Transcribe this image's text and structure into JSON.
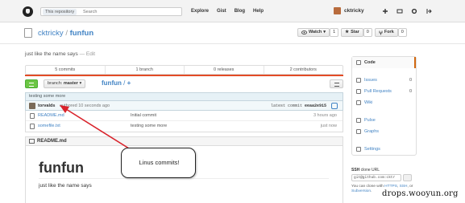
{
  "header": {
    "search_scope": "This repository",
    "search_placeholder": "Search",
    "nav": [
      "Explore",
      "Gist",
      "Blog",
      "Help"
    ],
    "username": "cktricky"
  },
  "repo": {
    "owner": "cktricky",
    "separator": "/",
    "name": "funfun",
    "watch_label": "Watch",
    "watch_count": "1",
    "star_label": "Star",
    "star_count": "0",
    "fork_label": "Fork",
    "fork_count": "0",
    "description": "just like the name says",
    "edit_label": "— Edit"
  },
  "stats": [
    "5 commits",
    "1 branch",
    "0 releases",
    "2 contributors"
  ],
  "branch": {
    "prefix": "branch:",
    "name": "master",
    "breadcrumb_repo": "funfun",
    "breadcrumb_sep": "/",
    "breadcrumb_plus": "+"
  },
  "commit": {
    "message": "testing some more",
    "author": "torvalds",
    "authored": "authored 10 seconds ago",
    "latest_prefix": "latest commit",
    "sha": "eeaa2e915"
  },
  "files": [
    {
      "name": "README.md",
      "message": "Initial commit",
      "age": "3 hours ago"
    },
    {
      "name": "somefile.txt",
      "message": "testing some more",
      "age": "just now"
    }
  ],
  "readme": {
    "filename": "README.md",
    "heading": "funfun",
    "body": "just like the name says"
  },
  "annotation": {
    "text": "Linus commits!"
  },
  "sidebar": {
    "items": [
      {
        "label": "Code",
        "count": ""
      },
      {
        "label": "Issues",
        "count": "0"
      },
      {
        "label": "Pull Requests",
        "count": "0"
      },
      {
        "label": "Wiki",
        "count": ""
      },
      {
        "label": "Pulse",
        "count": ""
      },
      {
        "label": "Graphs",
        "count": ""
      },
      {
        "label": "Settings",
        "count": ""
      }
    ],
    "clone_label_bold": "SSH",
    "clone_label_rest": "clone URL",
    "clone_url": "git@github.com:cktr",
    "clone_help_prefix": "You can clone with",
    "clone_https": "HTTPS",
    "clone_ssh": "SSH",
    "clone_or": "or",
    "clone_subversion": "Subversion"
  },
  "watermark": "drops.wooyun.org",
  "colors": {
    "link": "#4183c4",
    "compare_green": "#6cc644",
    "arrow_red": "#d9232b",
    "language_bar": "#e34c26"
  }
}
